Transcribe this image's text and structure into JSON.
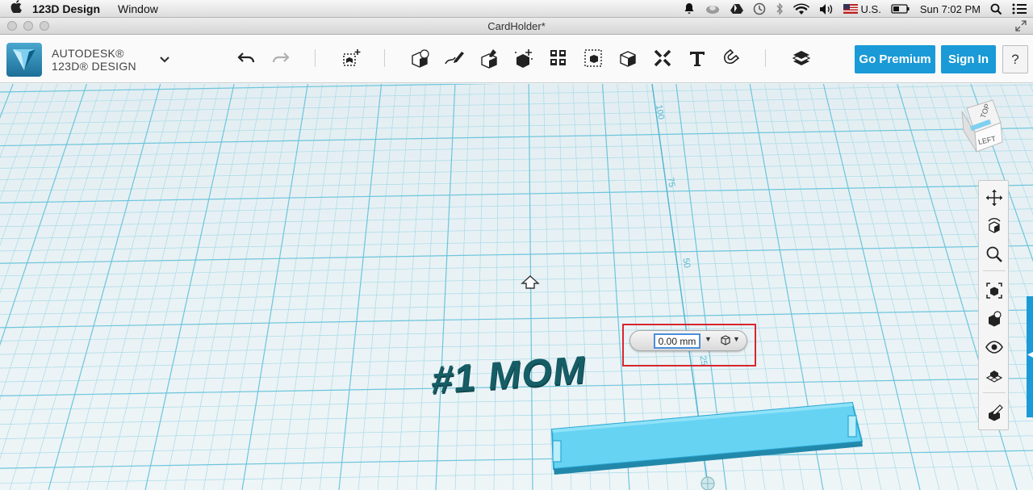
{
  "menubar": {
    "app_name": "123D Design",
    "menu_items": [
      "Window"
    ],
    "locale": "U.S.",
    "clock": "Sun 7:02 PM"
  },
  "window": {
    "title": "CardHolder*"
  },
  "brand": {
    "line1": "AUTODESK®",
    "line2": "123D® DESIGN"
  },
  "toolbar": {
    "premium_label": "Go Premium",
    "signin_label": "Sign In",
    "help_label": "?",
    "icons": [
      "undo-icon",
      "redo-icon",
      "transform-icon",
      "primitives-icon",
      "sketch-icon",
      "construct-icon",
      "modify-icon",
      "pattern-icon",
      "grouping-icon",
      "combine-icon",
      "measure-icon",
      "text-icon",
      "snap-icon",
      "materials-icon"
    ]
  },
  "viewport": {
    "text_object": "#1 MOM",
    "value_field": "0.00 mm",
    "ruler_labels": [
      "100",
      "75",
      "50",
      "25"
    ],
    "viewcube_top": "TOP",
    "viewcube_left": "LEFT"
  },
  "nav_panel": {
    "icons": [
      "pan-icon",
      "orbit-icon",
      "zoom-icon",
      "fit-icon",
      "views-icon",
      "visibility-icon",
      "material-grid-icon",
      "settings-icon"
    ]
  },
  "colors": {
    "accent": "#1a9ad6",
    "grid": "#6cc5dc",
    "text_object": "#165d66",
    "highlight": "#d6262e",
    "slab": "#66d3f3"
  }
}
